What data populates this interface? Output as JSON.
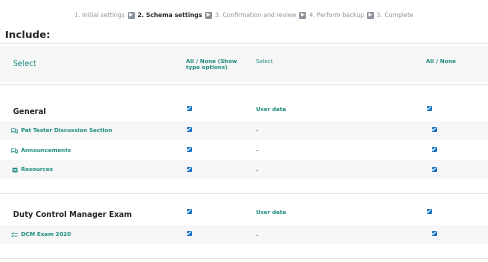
{
  "steps": {
    "s1": "1. Initial settings",
    "s2": "2. Schema settings",
    "s3": "3. Confirmation and review",
    "s4": "4. Perform backup",
    "s5": "5. Complete"
  },
  "include_title": "Include:",
  "header": {
    "select": "Select",
    "all_none_show": "All / None (Show type options)",
    "select2": "Select",
    "all_none": "All / None"
  },
  "sections": [
    {
      "title": "General",
      "user_data": "User data",
      "items": [
        {
          "label": "Pat Tester Discussion Section",
          "icon": "forum-icon",
          "value": "-"
        },
        {
          "label": "Announcements",
          "icon": "forum-icon",
          "value": "-"
        },
        {
          "label": "Resources",
          "icon": "folder-icon",
          "value": "-"
        }
      ]
    },
    {
      "title": "Duty Control Manager Exam",
      "user_data": "User data",
      "items": [
        {
          "label": "DCM Exam 2020",
          "icon": "quiz-icon",
          "value": "-"
        }
      ]
    }
  ],
  "colors": {
    "accent": "#1a8a7d",
    "checkbox": "#0f6cbf",
    "band": "#f7f7f8"
  }
}
